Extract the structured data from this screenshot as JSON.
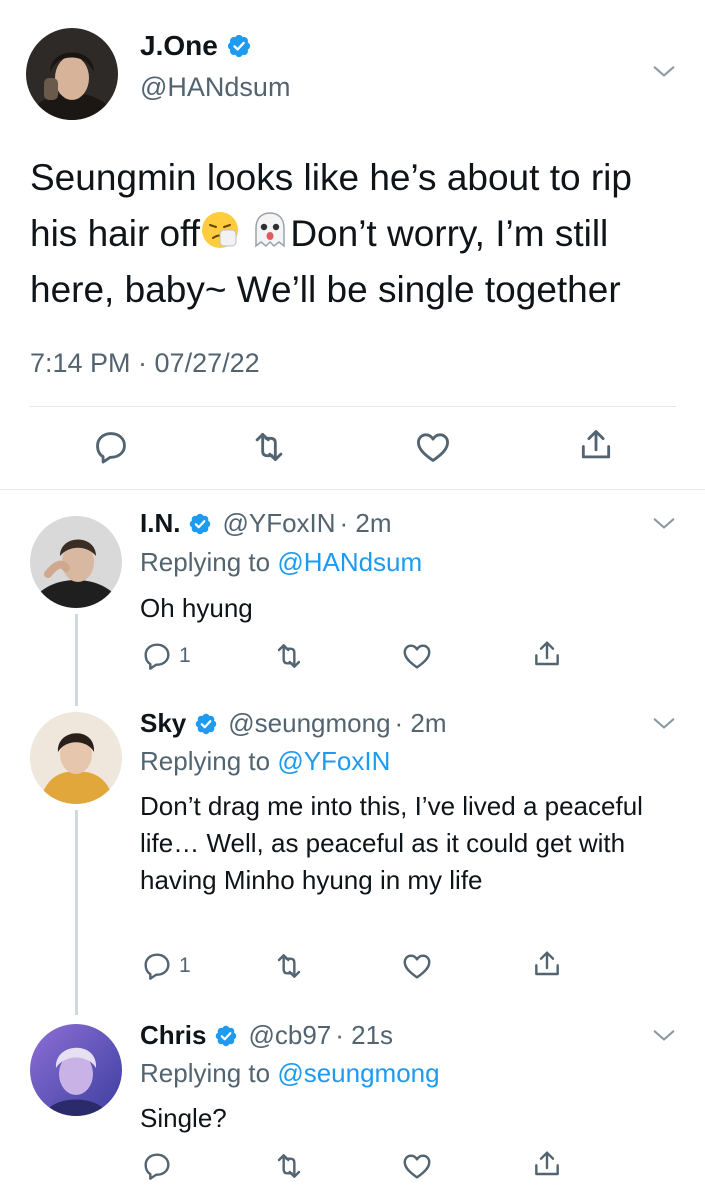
{
  "main_tweet": {
    "display_name": "J.One",
    "handle": "@HANdsum",
    "text_part1": "Seungmin looks like he’s about to rip his hair off",
    "text_part2": "Don’t worry, I’m still here, baby~ We’ll be single together",
    "emojis": [
      "sneezing-face-emoji",
      "ghost-emoji"
    ],
    "timestamp": "7:14 PM · 07/27/22"
  },
  "replies": [
    {
      "display_name": "I.N.",
      "handle": "@YFoxIN",
      "time": "· 2m",
      "replying_prefix": "Replying to ",
      "replying_to": "@HANdsum",
      "text": "Oh hyung",
      "reply_count": "1"
    },
    {
      "display_name": "Sky",
      "handle": "@seungmong",
      "time": "· 2m",
      "replying_prefix": "Replying to ",
      "replying_to": "@YFoxIN",
      "text": "Don’t drag me into this, I’ve lived a peaceful life… Well, as peaceful as it could get with having Minho hyung in my life",
      "reply_count": "1"
    },
    {
      "display_name": "Chris",
      "handle": "@cb97",
      "time": "· 21s",
      "replying_prefix": "Replying to ",
      "replying_to": "@seungmong",
      "text": "Single?",
      "reply_count": ""
    }
  ],
  "icons": [
    "reply-icon",
    "retweet-icon",
    "like-icon",
    "share-icon",
    "chevron-down-icon",
    "verified-badge-icon"
  ],
  "colors": {
    "accent": "#1d9bf0",
    "text": "#0f1419",
    "muted": "#536471",
    "divider": "#e3e7ea",
    "thread_line": "#cfd9de"
  }
}
